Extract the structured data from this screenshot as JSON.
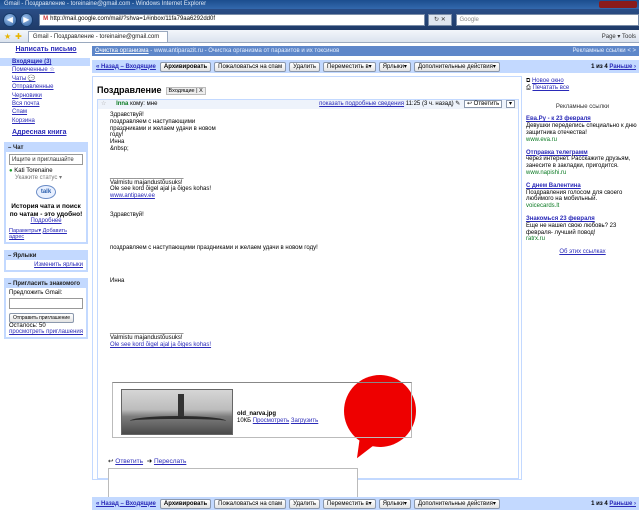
{
  "window": {
    "title": "Gmail - Поздравление - toreinaine@gmail.com - Windows Internet Explorer"
  },
  "browser": {
    "url_prefix": "M",
    "url": "http://mail.google.com/mail/?shva=1#inbox/11fa79aa6292dd0f",
    "search_placeholder": "Google",
    "tab_title": "Gmail - Поздравление - toreinaine@gmail.com",
    "tools": "Page ▾  Tools"
  },
  "sidebar": {
    "compose": "Написать письмо",
    "items": [
      {
        "label": "Входящие (3)",
        "active": true
      },
      {
        "label": "Помеченные ☆"
      },
      {
        "label": "Чаты 💬"
      },
      {
        "label": "Отправленные"
      },
      {
        "label": "Черновики"
      },
      {
        "label": "Вся почта"
      },
      {
        "label": "Спам"
      },
      {
        "label": "Корзина"
      }
    ],
    "contacts": "Адресная книга",
    "chat": {
      "header": "– Чат",
      "search": "Ищите и приглашайте",
      "user": "Kati Torenaine",
      "status": "Укажите статус",
      "talk": "talk",
      "why": "История чата и поиск по чатам - это удобно!",
      "more": "Подробнее",
      "options": "Параметры▾",
      "add": "Добавить адрес"
    },
    "labels": {
      "header": "– Ярлыки",
      "edit": "Изменить ярлыки"
    },
    "invite": {
      "header": "– Пригласить знакомого",
      "prompt": "Предложить Gmail:",
      "button": "Отправить приглашение",
      "remaining": "Осталось: 50",
      "view": "просмотреть приглашения"
    }
  },
  "topbar": {
    "ad_link": "Очистка организма",
    "ad_text": " - www.antiparazit.ru - Очистка организма от паразитов и их токсинов",
    "web_clip": "Рекламные ссылки  < >"
  },
  "toolbar": {
    "back": "« Назад – Входящие",
    "archive": "Архивировать",
    "spam": "Пожаловаться на спам",
    "delete": "Удалить",
    "move": "Переместить в▾",
    "labels": "Ярлыки▾",
    "more": "Дополнительные действия▾",
    "pager_text": "1 из 4",
    "older": "Раньше ›"
  },
  "message": {
    "subject": "Поздравление",
    "label": "Входящие | X",
    "sender": "Inna",
    "to": "кому: мне",
    "details": "показать подробные сведения",
    "time": "11:25 (3 ч. назад)",
    "reply": "Ответить",
    "body_1": "Здравствуй!\nпоздравляем с наступающими\nпраздниками и желаем удачи в новом\nгоду!\nИнна\n&nbsp;",
    "body_2": "______________________\nValmistu majandustõusuks!\nOle see kord õigel ajal ja õiges kohas!",
    "body_2_link": "www.antipaev.ee",
    "body_3": "Здравствуй!",
    "body_4": "поздравляем с наступающими праздниками и желаем удачи в новом году!",
    "body_5": "Инна",
    "body_6": "______________________\nValmistu majandustõusuks!",
    "body_6_link": "Ole see kord õigel ajal ja õiges kohas!",
    "attachment": {
      "filename": "old_narva.jpg",
      "size": "10КБ",
      "view": "Просмотреть",
      "download": "Загрузить"
    },
    "reply_link": "Ответить",
    "forward_link": "Переслать"
  },
  "right": {
    "new_window": "Новое окно",
    "print_all": "Печатать все",
    "ads_header": "Рекламные ссылки",
    "ads": [
      {
        "title": "Ева.Ру - к 23 февраля",
        "text": "Девушки переделись специально к дню защитника отечества!",
        "url": "www.eva.ru"
      },
      {
        "title": "Отправка телеграмм",
        "text": "через интернет. Расскажите друзьям, занесите в закладки, пригодится.",
        "url": "www.napishi.ru"
      },
      {
        "title": "С днем Валентина",
        "text": "Поздравления голосом для своего любимого на мобильный.",
        "url": "voicecards.lt"
      },
      {
        "title": "Знакомься 23 февраля",
        "text": "Еще не нашел свою любовь? 23 февраля- лучший повод!",
        "url": "ratrx.ru"
      }
    ],
    "other": "Об этих ссылках"
  }
}
